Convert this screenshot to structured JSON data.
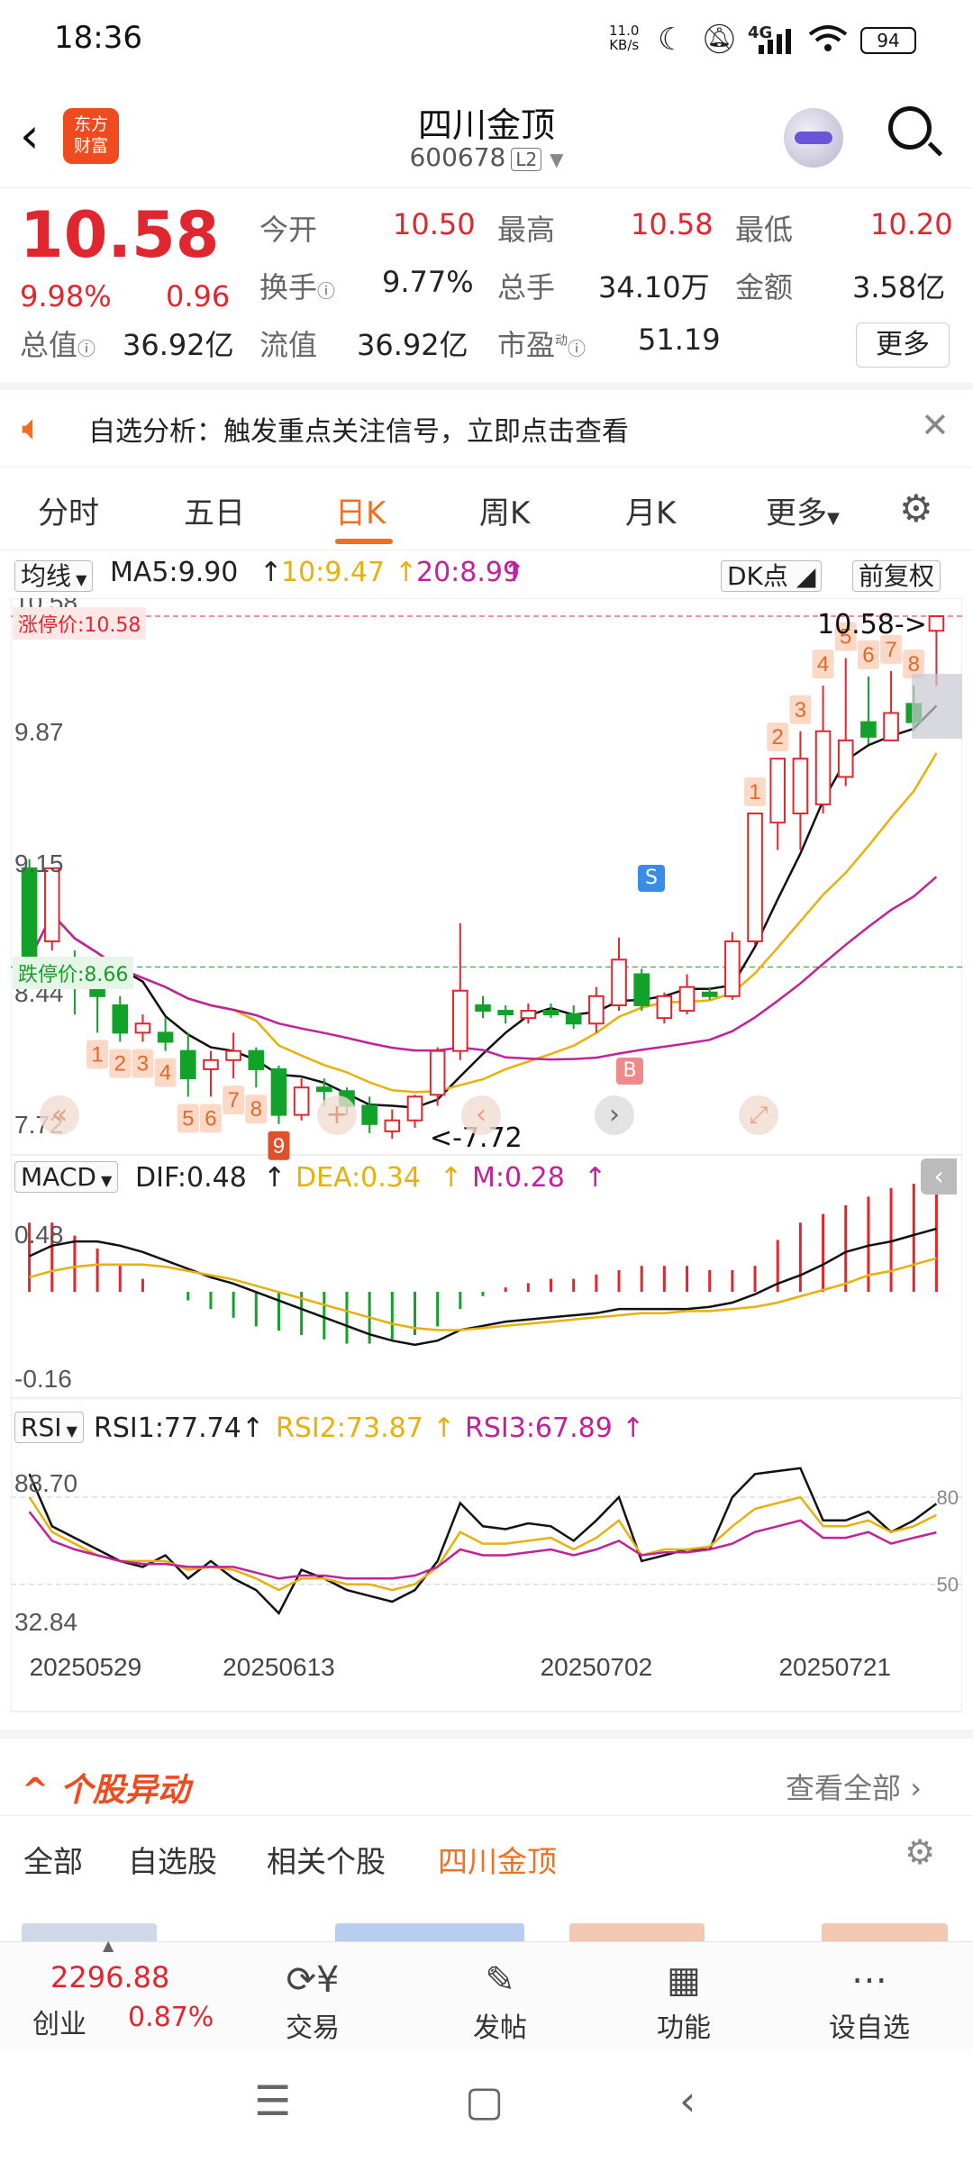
{
  "status": {
    "time": "18:36",
    "net_speed": "11.0",
    "net_unit": "KB/s",
    "signal": "4G",
    "battery": "94"
  },
  "header": {
    "logo_line1": "东方",
    "logo_line2": "财富",
    "stock_name": "四川金顶",
    "stock_code": "600678",
    "badge": "L2"
  },
  "quote": {
    "price": "10.58",
    "change_pct": "9.98%",
    "change": "0.96",
    "open_label": "今开",
    "open": "10.50",
    "high_label": "最高",
    "high": "10.58",
    "low_label": "最低",
    "low": "10.20",
    "turnover_label": "换手",
    "turnover": "9.77%",
    "volume_label": "总手",
    "volume": "34.10万",
    "amount_label": "金额",
    "amount": "3.58亿",
    "mktcap_label": "总值",
    "mktcap": "36.92亿",
    "float_label": "流值",
    "float": "36.92亿",
    "pe_label": "市盈",
    "pe_sup": "动",
    "pe": "51.19",
    "more": "更多"
  },
  "notice": {
    "text": "自选分析：触发重点关注信号，立即点击查看"
  },
  "tabs": [
    "分时",
    "五日",
    "日K",
    "周K",
    "月K",
    "更多"
  ],
  "chart": {
    "ma_select": "均线",
    "ma5": "MA5:9.90",
    "ma10": "10:9.47",
    "ma20": "20:8.99",
    "dk": "DK点",
    "adjust": "前复权",
    "limit_up_label": "涨停价:10.58",
    "limit_down_label": "跌停价:8.66",
    "y_labels": [
      "10.58",
      "9.87",
      "9.15",
      "8.44",
      "7.72"
    ],
    "max_annot": "10.58->",
    "min_annot": "<-7.72",
    "macd_select": "MACD",
    "dif": "DIF:0.48",
    "dea": "DEA:0.34",
    "m": "M:0.28",
    "macd_y": [
      "0.48",
      "-0.16"
    ],
    "rsi_select": "RSI",
    "rsi1": "RSI1:77.74",
    "rsi2": "RSI2:73.87",
    "rsi3": "RSI3:67.89",
    "rsi_y": [
      "88.70",
      "32.84"
    ],
    "rsi_levels": [
      "80",
      "50"
    ],
    "dates": [
      "20250529",
      "20250613",
      "20250702",
      "20250721"
    ],
    "s_tag": "S",
    "b_tag": "B",
    "colors": {
      "up": "#e0262f",
      "down": "#12a22a",
      "ma5": "#111111",
      "ma10": "#e8b00a",
      "ma20": "#c0229a"
    }
  },
  "chart_data": {
    "type": "candlestick",
    "candles": [
      [
        9.2,
        8.7,
        9.25,
        8.65
      ],
      [
        8.8,
        9.2,
        9.2,
        8.75
      ],
      [
        8.7,
        8.55,
        8.75,
        8.4
      ],
      [
        8.55,
        8.5,
        8.6,
        8.3
      ],
      [
        8.45,
        8.3,
        8.5,
        8.25
      ],
      [
        8.3,
        8.35,
        8.4,
        8.25
      ],
      [
        8.3,
        8.25,
        8.38,
        8.2
      ],
      [
        8.2,
        8.05,
        8.3,
        7.95
      ],
      [
        8.1,
        8.15,
        8.2,
        7.95
      ],
      [
        8.15,
        8.2,
        8.3,
        8.05
      ],
      [
        8.2,
        8.1,
        8.22,
        8.0
      ],
      [
        8.1,
        7.85,
        8.12,
        7.8
      ],
      [
        7.85,
        8.0,
        8.05,
        7.82
      ],
      [
        8.0,
        7.98,
        8.05,
        7.9
      ],
      [
        7.98,
        7.9,
        8.0,
        7.85
      ],
      [
        7.9,
        7.8,
        7.95,
        7.75
      ],
      [
        7.76,
        7.82,
        7.88,
        7.72
      ],
      [
        7.82,
        7.95,
        7.96,
        7.78
      ],
      [
        7.96,
        8.2,
        8.22,
        7.9
      ],
      [
        8.2,
        8.53,
        8.9,
        8.15
      ],
      [
        8.45,
        8.42,
        8.5,
        8.38
      ],
      [
        8.42,
        8.4,
        8.45,
        8.35
      ],
      [
        8.38,
        8.42,
        8.46,
        8.35
      ],
      [
        8.42,
        8.4,
        8.46,
        8.38
      ],
      [
        8.4,
        8.35,
        8.45,
        8.32
      ],
      [
        8.35,
        8.5,
        8.55,
        8.3
      ],
      [
        8.45,
        8.7,
        8.82,
        8.42
      ],
      [
        8.62,
        8.45,
        8.65,
        8.42
      ],
      [
        8.38,
        8.5,
        8.52,
        8.35
      ],
      [
        8.42,
        8.55,
        8.62,
        8.4
      ],
      [
        8.52,
        8.5,
        8.55,
        8.48
      ],
      [
        8.5,
        8.8,
        8.85,
        8.48
      ],
      [
        8.8,
        9.5,
        9.5,
        8.78
      ],
      [
        9.45,
        9.8,
        9.8,
        9.3
      ],
      [
        9.5,
        9.8,
        9.95,
        9.3
      ],
      [
        9.55,
        9.95,
        10.2,
        9.5
      ],
      [
        9.7,
        9.9,
        10.35,
        9.65
      ],
      [
        10.0,
        9.92,
        10.25,
        9.88
      ],
      [
        9.9,
        10.05,
        10.28,
        9.9
      ],
      [
        10.1,
        10.0,
        10.2,
        9.95
      ],
      [
        10.5,
        10.58,
        10.58,
        10.2
      ]
    ],
    "ylim": [
      7.72,
      10.58
    ],
    "x_ticks": [
      "20250529",
      "20250613",
      "20250702",
      "20250721"
    ],
    "annotations": [
      "1",
      "2",
      "3",
      "4",
      "5",
      "6",
      "7",
      "8",
      "9",
      "1",
      "2",
      "3",
      "4",
      "5",
      "6",
      "7",
      "8"
    ],
    "series_names": [
      "MA5",
      "MA10",
      "MA20"
    ],
    "macd_dif_last": 0.48,
    "macd_dea_last": 0.34,
    "macd_m_last": 0.28,
    "rsi1_last": 77.74,
    "rsi2_last": 73.87,
    "rsi3_last": 67.89,
    "rsi_ylim": [
      32.84,
      88.7
    ]
  },
  "section": {
    "title": "个股异动",
    "more": "查看全部"
  },
  "filters": [
    "全部",
    "自选股",
    "相关个股",
    "四川金顶"
  ],
  "bottom": {
    "index_value": "2296.88",
    "index_name": "创业",
    "index_change": "0.87%",
    "nav": [
      "交易",
      "发帖",
      "功能",
      "设自选"
    ]
  }
}
